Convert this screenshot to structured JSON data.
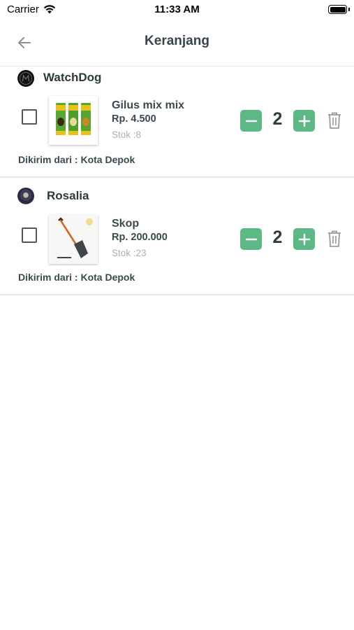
{
  "status_bar": {
    "carrier": "Carrier",
    "time": "11:33 AM"
  },
  "header": {
    "title": "Keranjang",
    "back_icon": "arrow-left-icon"
  },
  "colors": {
    "accent": "#5cb985",
    "text": "#35474a",
    "muted": "#aab0b2",
    "divider": "#e6e6e6"
  },
  "shops": [
    {
      "name": "WatchDog",
      "items": [
        {
          "name": "Gilus mix mix",
          "price": "Rp. 4.500",
          "stock": "Stok :8",
          "quantity": "2",
          "selected": false,
          "image": "snack-packs-image"
        }
      ],
      "ship_from": "Dikirim dari : Kota Depok"
    },
    {
      "name": "Rosalia",
      "items": [
        {
          "name": "Skop",
          "price": "Rp. 200.000",
          "stock": "Stok :23",
          "quantity": "2",
          "selected": false,
          "image": "shovel-image"
        }
      ],
      "ship_from": "Dikirim dari : Kota Depok"
    }
  ]
}
